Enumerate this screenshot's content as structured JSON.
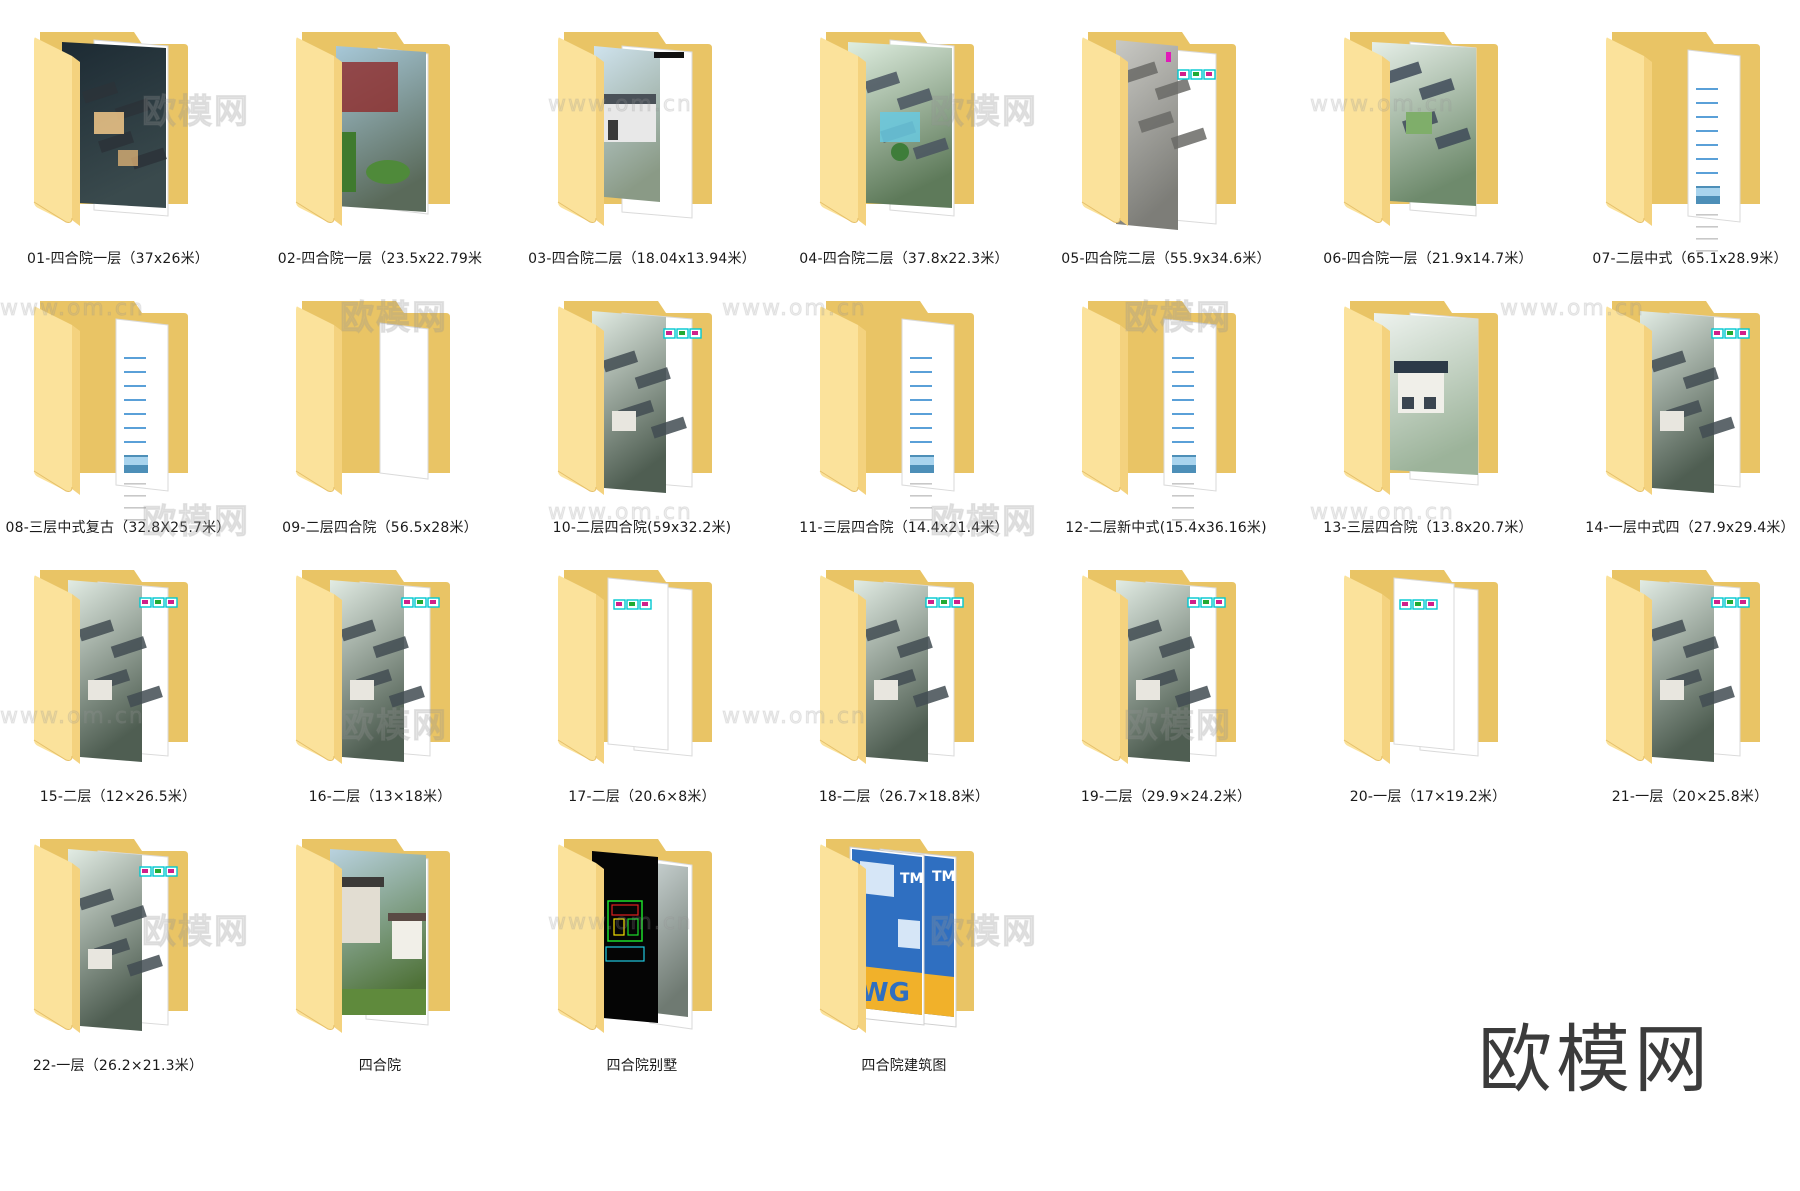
{
  "folders": [
    {
      "label": "01-四合院一层（37x26米）",
      "thumb": "render-night"
    },
    {
      "label": "02-四合院一层（23.5x22.79米",
      "thumb": "render-garden"
    },
    {
      "label": "03-四合院二层（18.04x13.94米）",
      "thumb": "render-street"
    },
    {
      "label": "04-四合院二层（37.8x22.3米）",
      "thumb": "render-aerial-pool"
    },
    {
      "label": "05-四合院二层（55.9x34.6米）",
      "thumb": "render-aerial-gray"
    },
    {
      "label": "06-四合院一层（21.9x14.7米）",
      "thumb": "render-aerial-roof"
    },
    {
      "label": "07-二层中式（65.1x28.9米）",
      "thumb": "document"
    },
    {
      "label": "08-三层中式复古（32.8X25.7米）",
      "thumb": "document"
    },
    {
      "label": "09-二层四合院（56.5x28米）",
      "thumb": "empty"
    },
    {
      "label": "10-二层四合院(59x32.2米)",
      "thumb": "render-cad"
    },
    {
      "label": "11-三层四合院（14.4x21.4米）",
      "thumb": "document"
    },
    {
      "label": "12-二层新中式(15.4x36.16米)",
      "thumb": "document"
    },
    {
      "label": "13-三层四合院（13.8x20.7米）",
      "thumb": "render-house-mist"
    },
    {
      "label": "14-一层中式四（27.9x29.4米）",
      "thumb": "render-cad"
    },
    {
      "label": "15-二层（12×26.5米）",
      "thumb": "render-cad"
    },
    {
      "label": "16-二层（13×18米）",
      "thumb": "render-cad"
    },
    {
      "label": "17-二层（20.6×8米）",
      "thumb": "cad-only"
    },
    {
      "label": "18-二层（26.7×18.8米）",
      "thumb": "render-cad"
    },
    {
      "label": "19-二层（29.9×24.2米）",
      "thumb": "render-cad"
    },
    {
      "label": "20-一层（17×19.2米）",
      "thumb": "cad-only"
    },
    {
      "label": "21-一层（20×25.8米）",
      "thumb": "render-cad"
    },
    {
      "label": "22-一层（26.2×21.3米）",
      "thumb": "render-cad"
    },
    {
      "label": "四合院",
      "thumb": "render-house-green"
    },
    {
      "label": "四合院别墅",
      "thumb": "cad-black"
    },
    {
      "label": "四合院建筑图",
      "thumb": "dwg"
    }
  ],
  "watermarks": {
    "brand_text": "欧模网",
    "url_text": "www.om.cn"
  },
  "colors": {
    "folder_back": "#e9c465",
    "folder_front": "#fbe29b",
    "folder_front_shade": "#f4d27e",
    "label_text": "#1a1a1a"
  }
}
